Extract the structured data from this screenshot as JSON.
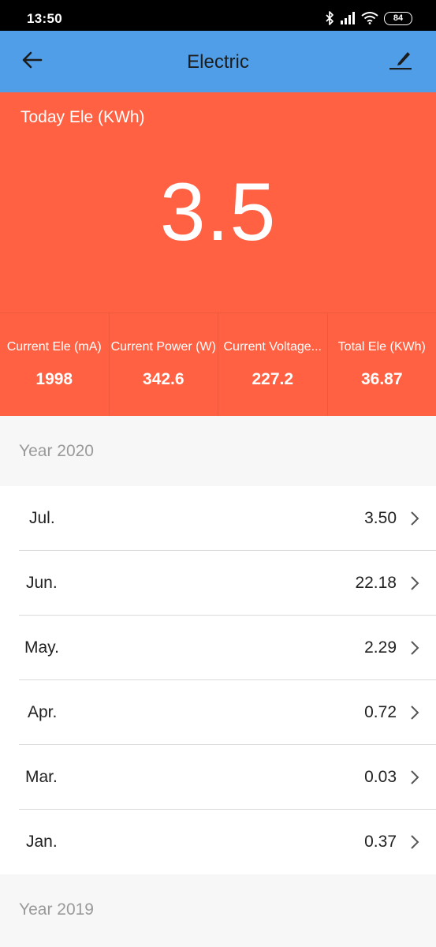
{
  "status_bar": {
    "time": "13:50",
    "battery": "84",
    "icons": [
      "bluetooth-icon",
      "signal-icon",
      "wifi-icon",
      "battery-icon"
    ]
  },
  "app_bar": {
    "title": "Electric",
    "back_icon": "arrow-left-icon",
    "edit_icon": "edit-pencil-icon",
    "color": "#4f9ee7"
  },
  "hero": {
    "label": "Today Ele (KWh)",
    "value": "3.5",
    "color": "#ff6142"
  },
  "stats": [
    {
      "label": "Current Ele (mA)",
      "value": "1998"
    },
    {
      "label": "Current Power (W)",
      "value": "342.6"
    },
    {
      "label": "Current Voltage...",
      "value": "227.2"
    },
    {
      "label": "Total Ele (KWh)",
      "value": "36.87"
    }
  ],
  "sections": [
    {
      "year": "Year 2020",
      "months": [
        {
          "name": "Jul.",
          "value": "3.50"
        },
        {
          "name": "Jun.",
          "value": "22.18"
        },
        {
          "name": "May.",
          "value": "2.29"
        },
        {
          "name": "Apr.",
          "value": "0.72"
        },
        {
          "name": "Mar.",
          "value": "0.03"
        },
        {
          "name": "Jan.",
          "value": "0.37"
        }
      ]
    },
    {
      "year": "Year 2019",
      "months": []
    }
  ]
}
